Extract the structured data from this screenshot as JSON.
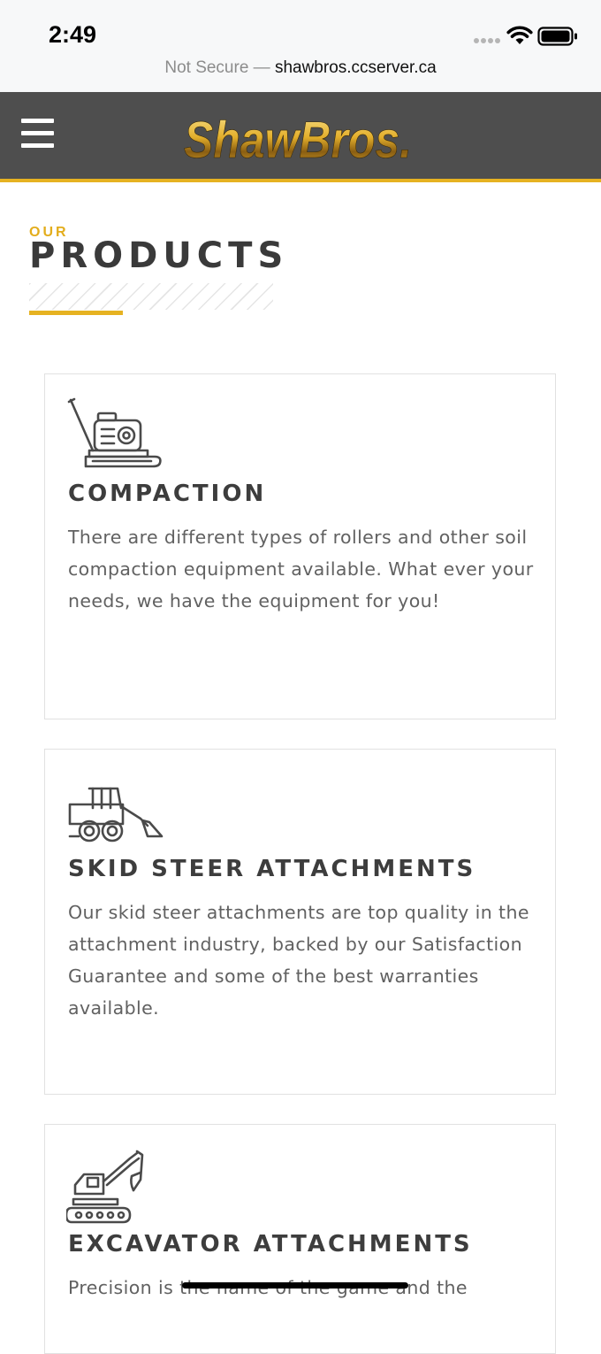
{
  "status_bar": {
    "time": "2:49"
  },
  "browser": {
    "security_label": "Not Secure —",
    "host": "shawbros.ccserver.ca"
  },
  "header": {
    "logo_text": "ShawBros.",
    "menu_icon": "hamburger-menu-icon"
  },
  "colors": {
    "accent": "#e6b221",
    "header_bg": "#4e4e4e",
    "title": "#3a3a3a",
    "body_text": "#616161"
  },
  "section": {
    "eyebrow": "OUR",
    "title": "PRODUCTS"
  },
  "products": [
    {
      "icon": "plate-compactor-icon",
      "title": "COMPACTION",
      "description": "There are different types of rollers and other soil compaction equipment available. What ever your needs, we have the equipment for you!"
    },
    {
      "icon": "skid-steer-icon",
      "title": "SKID STEER ATTACHMENTS",
      "description": "Our skid steer attachments are top quality in the attachment industry, backed by our Satisfaction Guarantee and some of the best warranties available."
    },
    {
      "icon": "excavator-icon",
      "title": "EXCAVATOR ATTACHMENTS",
      "description": "Precision is the name of the game and the"
    }
  ]
}
